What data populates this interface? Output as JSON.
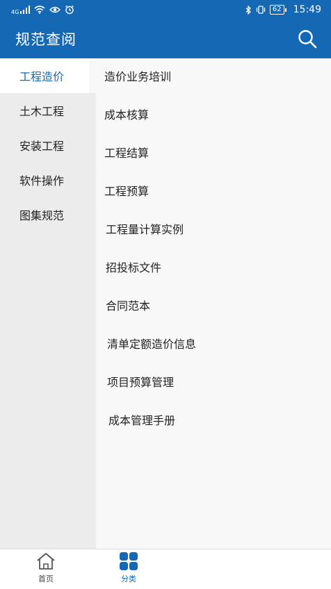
{
  "status_bar": {
    "network": "4G",
    "battery": "62",
    "time": "15:49"
  },
  "header": {
    "title": "规范查阅",
    "search_icon": "search-icon"
  },
  "categories": [
    {
      "label": "工程造价",
      "active": true
    },
    {
      "label": "土木工程",
      "active": false
    },
    {
      "label": "安装工程",
      "active": false
    },
    {
      "label": "软件操作",
      "active": false
    },
    {
      "label": "图集规范",
      "active": false
    }
  ],
  "items": [
    {
      "label": "造价业务培训"
    },
    {
      "label": "成本核算"
    },
    {
      "label": "工程结算"
    },
    {
      "label": "工程预算"
    },
    {
      "label": "工程量计算实例"
    },
    {
      "label": "招投标文件"
    },
    {
      "label": "合同范本"
    },
    {
      "label": "清单定额造价信息"
    },
    {
      "label": "项目预算管理"
    },
    {
      "label": "成本管理手册"
    }
  ],
  "tabs": [
    {
      "label": "首页",
      "icon": "home-icon",
      "active": false
    },
    {
      "label": "分类",
      "icon": "category-grid-icon",
      "active": true
    }
  ],
  "colors": {
    "brand": "#1568b4",
    "sidebar_bg": "#ececec",
    "content_bg": "#f8f8f8"
  }
}
